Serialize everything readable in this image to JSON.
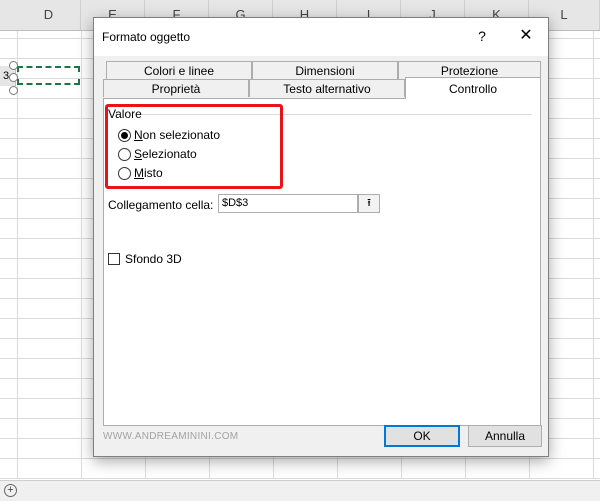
{
  "spreadsheet": {
    "columns": [
      "D",
      "E",
      "F",
      "G",
      "H",
      "I",
      "J",
      "K",
      "L"
    ],
    "row_number": "3"
  },
  "dialog": {
    "title": "Formato oggetto",
    "help": "?",
    "close": "✕",
    "tabs_back": [
      "Colori e linee",
      "Dimensioni",
      "Protezione"
    ],
    "tabs_front": [
      "Proprietà",
      "Testo alternativo",
      "Controllo"
    ],
    "active_tab": "Controllo",
    "group_label": "Valore",
    "radios": [
      {
        "label": "Non selezionato",
        "checked": true
      },
      {
        "label": "Selezionato",
        "checked": false
      },
      {
        "label": "Misto",
        "checked": false
      }
    ],
    "link_label": "Collegamento cella:",
    "link_value": "$D$3",
    "link_button_icon": "collapse-dialog-icon",
    "checkbox_label": "Sfondo 3D",
    "checkbox_checked": false,
    "watermark": "WWW.ANDREAMININI.COM",
    "ok_label": "OK",
    "cancel_label": "Annulla"
  },
  "colors": {
    "highlight": "#e8141b",
    "ok_border": "#0078d7",
    "selection": "#217346"
  }
}
